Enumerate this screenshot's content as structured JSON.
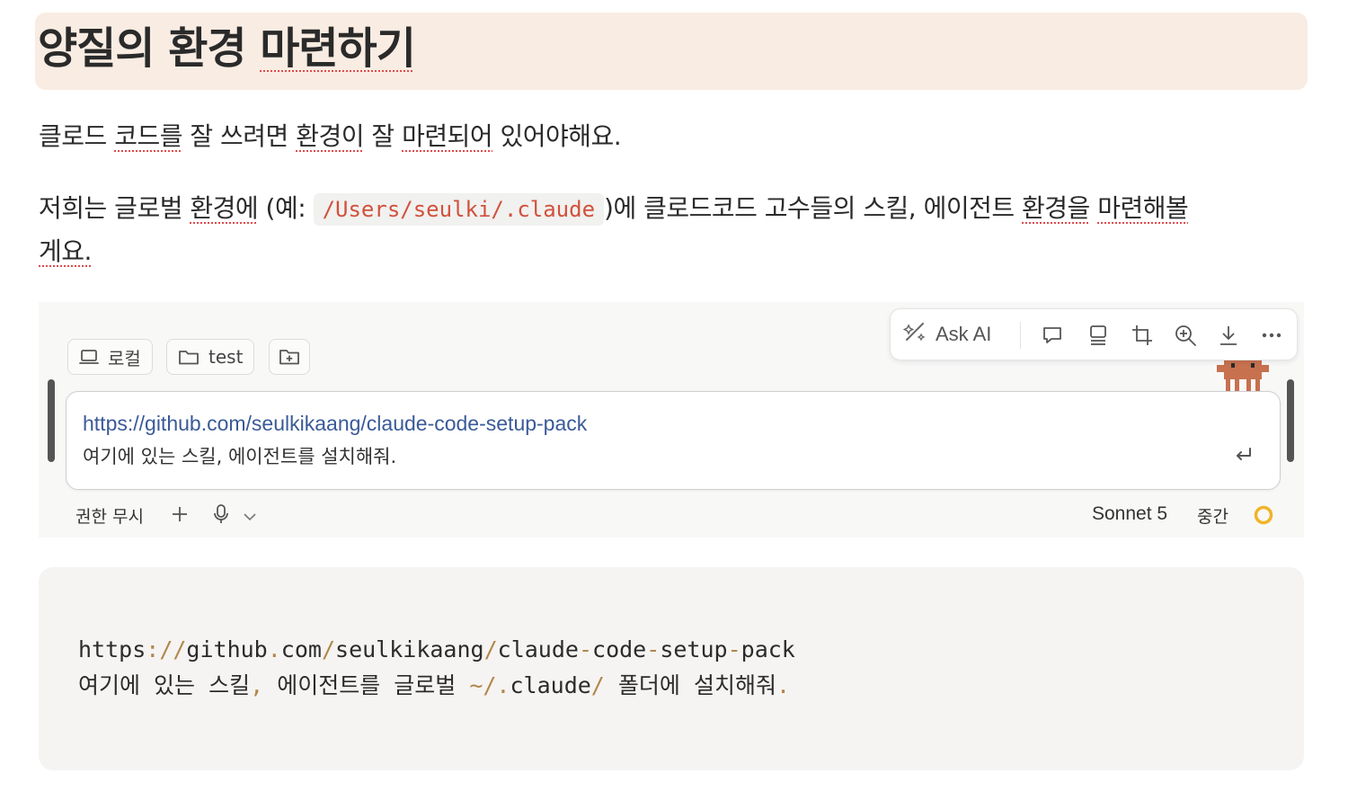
{
  "heading": {
    "part1": "양질의 환경 ",
    "part2": "마련하기"
  },
  "para1": {
    "s1": "클로드 ",
    "s2": "코드를",
    "s3": " 잘 쓰려면 ",
    "s4": "환경이",
    "s5": " 잘 ",
    "s6": "마련되어",
    "s7": " 있어야해요."
  },
  "para2": {
    "s1": "저희는 글로벌 ",
    "s2": "환경에",
    "s3": " (예: ",
    "code": "/Users/seulki/.claude",
    "s4": ")에 클로드코드 고수들의 스킬, 에이전트 ",
    "s5": "환경을",
    "s6": " ",
    "s7": "마련해볼",
    "s8": "게요."
  },
  "screenshot": {
    "chips": {
      "local": "로컬",
      "folder": "test"
    },
    "toolbar": {
      "ask_ai": "Ask AI",
      "icons": [
        "comment-icon",
        "caption-icon",
        "crop-icon",
        "zoom-in-icon",
        "download-icon",
        "more-icon"
      ]
    },
    "input": {
      "link": "https://github.com/seulkikaang/claude-code-setup-pack",
      "message": "여기에 있는 스킬, 에이전트를 설치해줘."
    },
    "bottom": {
      "permission": "권한 무시",
      "model": "Sonnet 5",
      "effort": "중간"
    },
    "colors": {
      "link": "#3a5a98",
      "mascot": "#c7714f",
      "ring": "#f0b429"
    }
  },
  "codeblock": {
    "line1": {
      "a": "https",
      "b": "://",
      "c": "github",
      "d": ".",
      "e": "com",
      "f": "/",
      "g": "seulkikaang",
      "h": "/",
      "i": "claude",
      "j": "-",
      "k": "code",
      "l": "-",
      "m": "setup",
      "n": "-",
      "o": "pack"
    },
    "line2": {
      "a": "여기에 있는 스킬",
      "b": ",",
      "c": " 에이전트를 글로벌 ",
      "d": "~/.",
      "e": "claude",
      "f": "/",
      "g": " 폴더에 설치해줘",
      "h": "."
    }
  }
}
